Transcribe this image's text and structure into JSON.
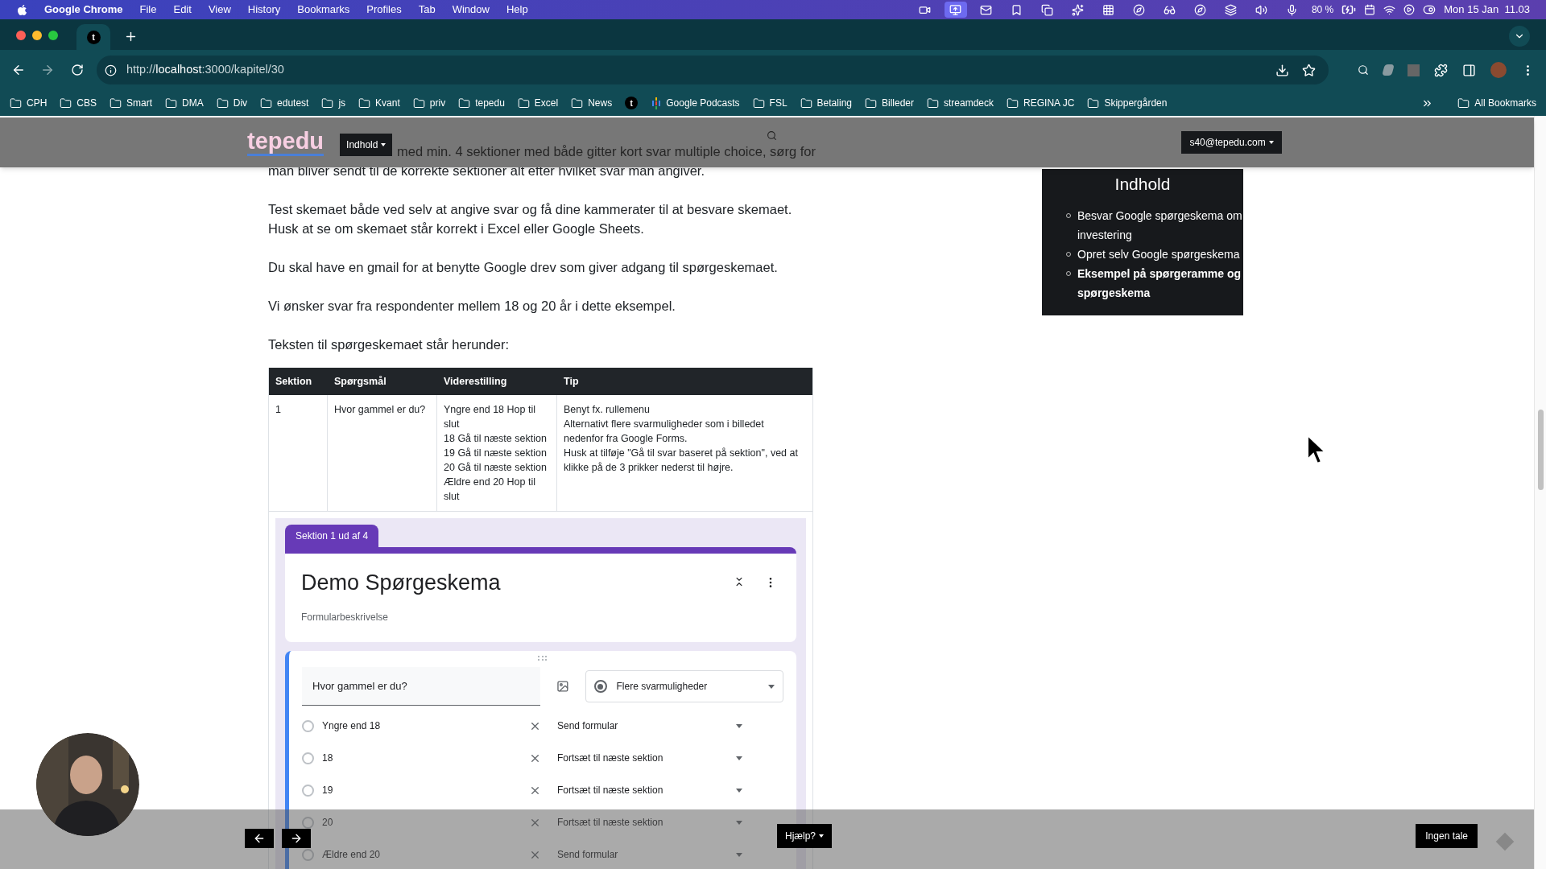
{
  "menu_bar": {
    "app": "Google Chrome",
    "menus": [
      "File",
      "Edit",
      "View",
      "History",
      "Bookmarks",
      "Profiles",
      "Tab",
      "Window",
      "Help"
    ],
    "battery": "80 %",
    "clock": "Mon 15 Jan  11.03"
  },
  "browser": {
    "tab_favicon": "t",
    "url": {
      "scheme": "http://",
      "host": "localhost",
      "rest": ":3000/kapitel/30"
    },
    "bookmarks": [
      {
        "label": "CPH",
        "kind": "folder"
      },
      {
        "label": "CBS",
        "kind": "folder"
      },
      {
        "label": "Smart",
        "kind": "folder"
      },
      {
        "label": "DMA",
        "kind": "folder"
      },
      {
        "label": "Div",
        "kind": "folder"
      },
      {
        "label": "edutest",
        "kind": "folder"
      },
      {
        "label": "js",
        "kind": "folder"
      },
      {
        "label": "Kvant",
        "kind": "folder"
      },
      {
        "label": "priv",
        "kind": "folder"
      },
      {
        "label": "tepedu",
        "kind": "folder"
      },
      {
        "label": "Excel",
        "kind": "folder"
      },
      {
        "label": "News",
        "kind": "folder"
      },
      {
        "label": "t",
        "kind": "favicon"
      },
      {
        "label": "Google Podcasts",
        "kind": "podcast"
      },
      {
        "label": "FSL",
        "kind": "folder"
      },
      {
        "label": "Betaling",
        "kind": "folder"
      },
      {
        "label": "Billeder",
        "kind": "folder"
      },
      {
        "label": "streamdeck",
        "kind": "folder"
      },
      {
        "label": "REGINA JC",
        "kind": "folder"
      },
      {
        "label": "Skippergården",
        "kind": "folder"
      }
    ],
    "all_bookmarks": "All Bookmarks"
  },
  "site_nav": {
    "logo": "tepedu",
    "menu_button": "Indhold",
    "user_button": "s40@tepedu.com"
  },
  "article": {
    "paragraphs": [
      [
        "med min. 4 sektioner med både gitter kort svar multiple choice, sørg for",
        "man bliver sendt til de korrekte sektioner alt efter hvilket svar man angiver."
      ],
      [
        "Test skemaet både ved selv at angive svar og få dine kammerater til at besvare skemaet.",
        "Husk at se om skemaet står korrekt i Excel eller Google Sheets."
      ],
      [
        "Du skal have en gmail for at benytte Google drev som giver adgang til spørgeskemaet."
      ],
      [
        "Vi ønsker svar fra respondenter mellem 18 og 20 år i dette eksempel."
      ],
      [
        "Teksten til spørgeskemaet står herunder:"
      ]
    ],
    "table": {
      "columns": [
        "Sektion",
        "Spørgsmål",
        "Viderestilling",
        "Tip"
      ],
      "rows": [
        {
          "cells": [
            [
              "1"
            ],
            [
              "Hvor gammel er du?"
            ],
            [
              "Yngre end 18 Hop til slut",
              "18 Gå til næste sektion",
              "19 Gå til næste sektion",
              "20 Gå til næste sektion",
              "Ældre end 20 Hop til slut"
            ],
            [
              "Benyt fx. rullemenu",
              "Alternativt flere svarmuligheder som i billedet nedenfor fra Google Forms.",
              "Husk at tilføje \"Gå til svar baseret på sektion\", ved at klikke på de 3 prikker nederst til højre."
            ]
          ]
        }
      ]
    },
    "form_preview": {
      "section_tab": "Sektion 1 ud af 4",
      "title": "Demo Spørgeskema",
      "description": "Formularbeskrivelse",
      "question": "Hvor gammel er du?",
      "question_type": "Flere svarmuligheder",
      "options": [
        {
          "label": "Yngre end 18",
          "goto": "Send formular",
          "selected": false
        },
        {
          "label": "18",
          "goto": "Fortsæt til næste sektion",
          "selected": false
        },
        {
          "label": "19",
          "goto": "Fortsæt til næste sektion",
          "selected": false
        },
        {
          "label": "20",
          "goto": "Fortsæt til næste sektion",
          "selected": false
        },
        {
          "label": "Ældre end 20",
          "goto": "Send formular",
          "selected": false
        }
      ]
    }
  },
  "toc": {
    "title": "Indhold",
    "items": [
      {
        "label": "Besvar Google spørgeskema om investering",
        "selected": false
      },
      {
        "label": "Opret selv Google spørgeskema",
        "selected": false
      },
      {
        "label": "Eksempel på spørgeramme og spørgeskema",
        "selected": true
      }
    ]
  },
  "bottom_bar": {
    "help_button": "Hjælp?",
    "speech_button": "Ingen tale"
  }
}
